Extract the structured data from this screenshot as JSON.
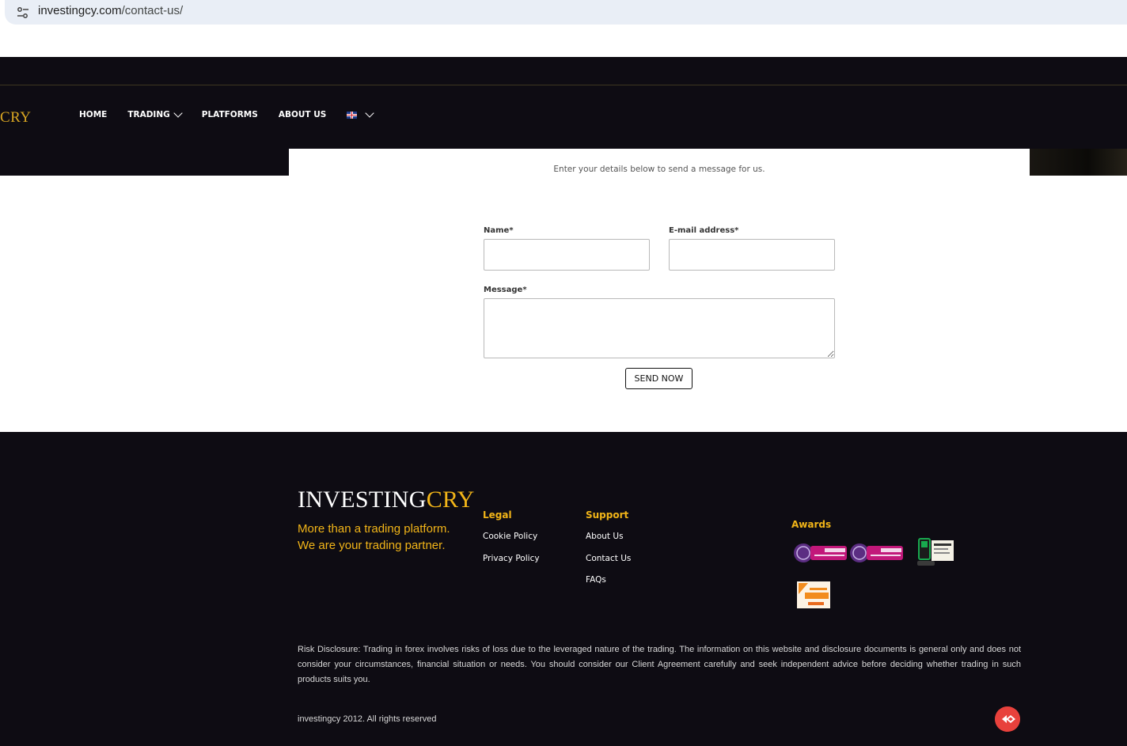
{
  "browser": {
    "url_domain": "investingcy.com",
    "url_path": "/contact-us/"
  },
  "header": {
    "logo_partial": "CRY",
    "nav": [
      {
        "label": "HOME"
      },
      {
        "label": "TRADING"
      },
      {
        "label": "PLATFORMS"
      },
      {
        "label": "ABOUT US"
      }
    ],
    "language_icon": "uk-flag-icon"
  },
  "contact": {
    "subtitle": "Enter your details below to send a message for us.",
    "name_label": "Name*",
    "name_value": "",
    "email_label": "E-mail address*",
    "email_value": "",
    "message_label": "Message*",
    "message_value": "",
    "send_label": "SEND NOW"
  },
  "footer": {
    "logo_main": "INVESTING",
    "logo_accent": "CRY",
    "tagline_line1": "More than a trading platform.",
    "tagline_line2": "We are your trading partner.",
    "legal": {
      "title": "Legal",
      "links": [
        "Cookie Policy",
        "Privacy Policy"
      ]
    },
    "support": {
      "title": "Support",
      "links": [
        "About Us",
        "Contact Us",
        "FAQs"
      ]
    },
    "awards": {
      "title": "Awards"
    },
    "risk_disclosure": "Risk Disclosure: Trading in forex involves risks of loss due to the leveraged nature of the trading. The information on this website and disclosure documents is general only and does not consider your circumstances, financial situation or needs. You should consider our Client Agreement carefully and seek independent advice before deciding whether trading in such products suits you.",
    "copyright": "investingcy 2012. All rights reserved"
  },
  "colors": {
    "dark_bg": "#0e0c13",
    "gold": "#f2b518",
    "chat_red": "#e8413c"
  }
}
